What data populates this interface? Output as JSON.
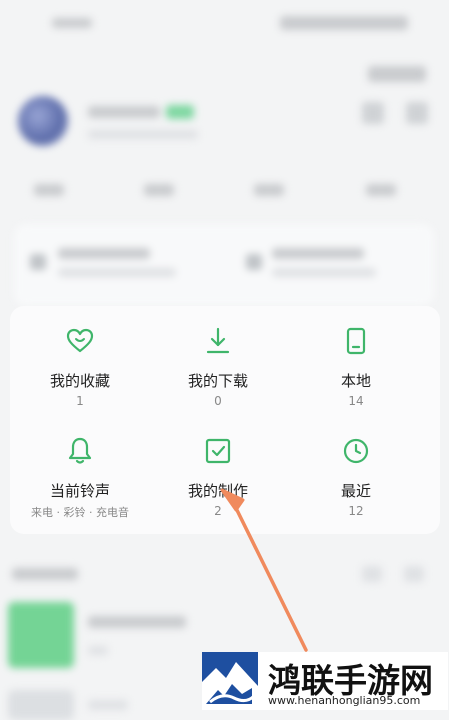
{
  "colors": {
    "accent": "#3fb56a",
    "annotation_arrow": "#f08a5d",
    "watermark_brand": "#1e4fa0"
  },
  "grid": {
    "items": [
      {
        "label": "我的收藏",
        "count": "1",
        "icon": "heart-icon"
      },
      {
        "label": "我的下载",
        "count": "0",
        "icon": "download-icon"
      },
      {
        "label": "本地",
        "count": "14",
        "icon": "phone-icon"
      },
      {
        "label": "当前铃声",
        "count": "来电 · 彩铃 · 充电音",
        "icon": "bell-icon"
      },
      {
        "label": "我的制作",
        "count": "2",
        "icon": "checkbox-icon"
      },
      {
        "label": "最近",
        "count": "12",
        "icon": "clock-icon"
      }
    ]
  },
  "watermark": {
    "title": "鸿联手游网",
    "url": "www.henanhonglian95.com"
  }
}
